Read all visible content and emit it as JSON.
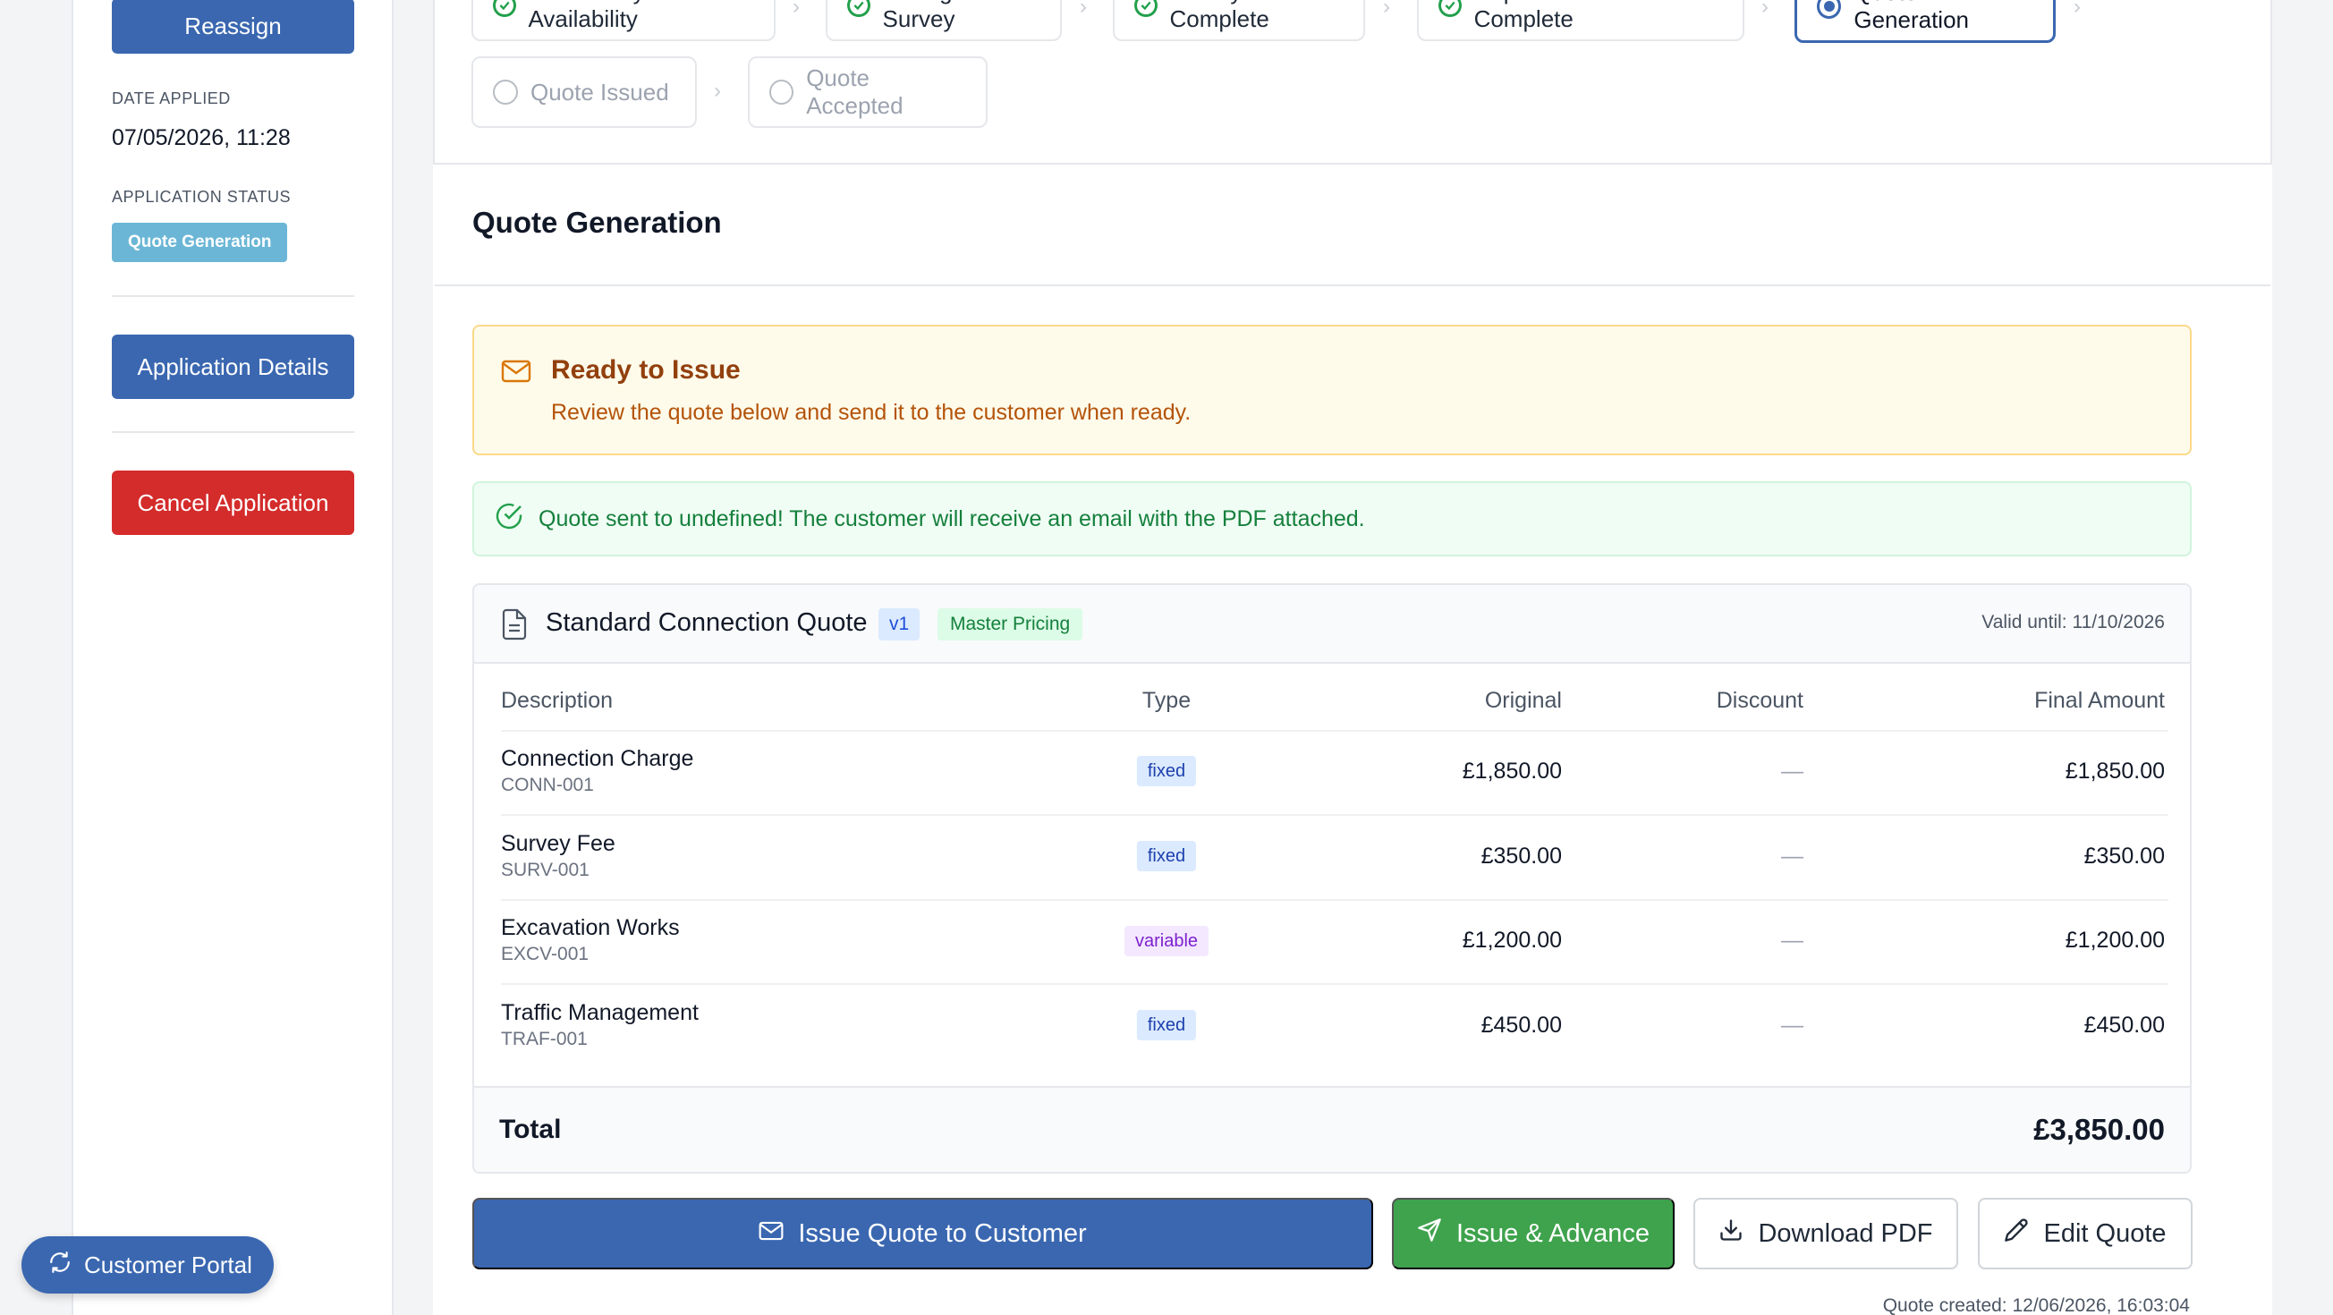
{
  "sidebar": {
    "reassign_label": "Reassign",
    "date_applied_label": "DATE APPLIED",
    "date_applied_value": "07/05/2026, 11:28",
    "status_label": "APPLICATION STATUS",
    "status_value": "Quote Generation",
    "application_details_label": "Application Details",
    "cancel_label": "Cancel Application",
    "customer_portal_label": "Customer Portal"
  },
  "steps": [
    {
      "label": "Get Survey Availability",
      "state": "complete"
    },
    {
      "label": "Arrange Survey",
      "state": "complete"
    },
    {
      "label": "Survey Complete",
      "state": "complete"
    },
    {
      "label": "Dependencies Complete",
      "state": "complete"
    },
    {
      "label": "Quote Generation",
      "state": "current"
    },
    {
      "label": "Quote Issued",
      "state": "pending"
    },
    {
      "label": "Quote Accepted",
      "state": "pending"
    }
  ],
  "card": {
    "title": "Quote Generation",
    "ready_title": "Ready to Issue",
    "ready_text": "Review the quote below and send it to the customer when ready.",
    "success_text": "Quote sent to undefined! The customer will receive an email with the PDF attached."
  },
  "quote": {
    "title": "Standard Connection Quote",
    "version": "v1",
    "pricing_badge": "Master Pricing",
    "valid_until": "Valid until: 11/10/2026",
    "columns": {
      "description": "Description",
      "type": "Type",
      "original": "Original",
      "discount": "Discount",
      "final": "Final Amount"
    },
    "rows": [
      {
        "description": "Connection Charge",
        "code": "CONN-001",
        "type": "fixed",
        "original": "£1,850.00",
        "discount": "—",
        "final": "£1,850.00"
      },
      {
        "description": "Survey Fee",
        "code": "SURV-001",
        "type": "fixed",
        "original": "£350.00",
        "discount": "—",
        "final": "£350.00"
      },
      {
        "description": "Excavation Works",
        "code": "EXCV-001",
        "type": "variable",
        "original": "£1,200.00",
        "discount": "—",
        "final": "£1,200.00"
      },
      {
        "description": "Traffic Management",
        "code": "TRAF-001",
        "type": "fixed",
        "original": "£450.00",
        "discount": "—",
        "final": "£450.00"
      }
    ],
    "total_label": "Total",
    "total_value": "£3,850.00"
  },
  "actions": {
    "issue_label": "Issue Quote to Customer",
    "issue_advance_label": "Issue & Advance",
    "download_label": "Download PDF",
    "edit_label": "Edit Quote"
  },
  "footer": {
    "created": "Quote created: 12/06/2026, 16:03:04"
  },
  "colors": {
    "primary": "#3a67b0",
    "danger": "#d42b2b",
    "success": "#3fa34d",
    "status_badge": "#6bb6d6"
  }
}
